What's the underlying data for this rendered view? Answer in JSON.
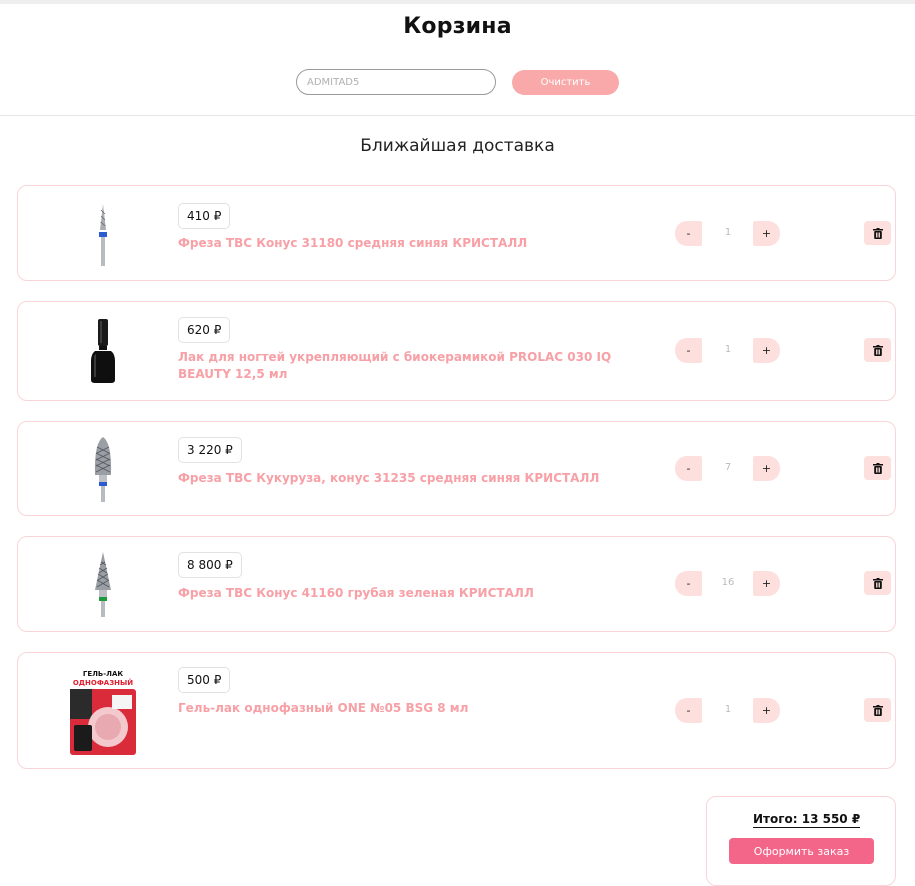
{
  "page": {
    "title": "Корзина"
  },
  "promo": {
    "placeholder": "ADMITAD5",
    "clear_label": "Очистить"
  },
  "section": {
    "title": "Ближайшая доставка"
  },
  "cart": {
    "items": [
      {
        "price": "410 ₽",
        "name": "Фреза ТВС Конус 31180 средняя синяя КРИСТАЛЛ",
        "qty": "1",
        "image": "bur-icon"
      },
      {
        "price": "620 ₽",
        "name": "Лак для ногтей укрепляющий с биокерамикой PROLAC 030 IQ BEAUTY 12,5 мл",
        "qty": "1",
        "image": "nail-polish-bottle"
      },
      {
        "price": "3 220 ₽",
        "name": "Фреза ТВС Кукуруза, конус 31235 средняя синяя КРИСТАЛЛ",
        "qty": "7",
        "image": "corn-bur-icon"
      },
      {
        "price": "8 800 ₽",
        "name": "Фреза ТВС Конус 41160 грубая зеленая КРИСТАЛЛ",
        "qty": "16",
        "image": "cone-bur-icon"
      },
      {
        "price": "500 ₽",
        "name": "Гель-лак однофазный ONE №05 BSG 8 мл",
        "qty": "1",
        "image": "gel-polish-package"
      }
    ],
    "minus_label": "-",
    "plus_label": "+",
    "package_text": {
      "line1": "ГЕЛЬ-ЛАК",
      "line2": "ОДНОФАЗНЫЙ"
    }
  },
  "summary": {
    "total": "Итого: 13 550 ₽",
    "checkout_label": "Оформить заказ"
  },
  "colors": {
    "accent": "#f3668a",
    "light_pink": "#fde0dd",
    "name_pink": "#f7a0a6",
    "clear_button": "#f9a9a9"
  }
}
